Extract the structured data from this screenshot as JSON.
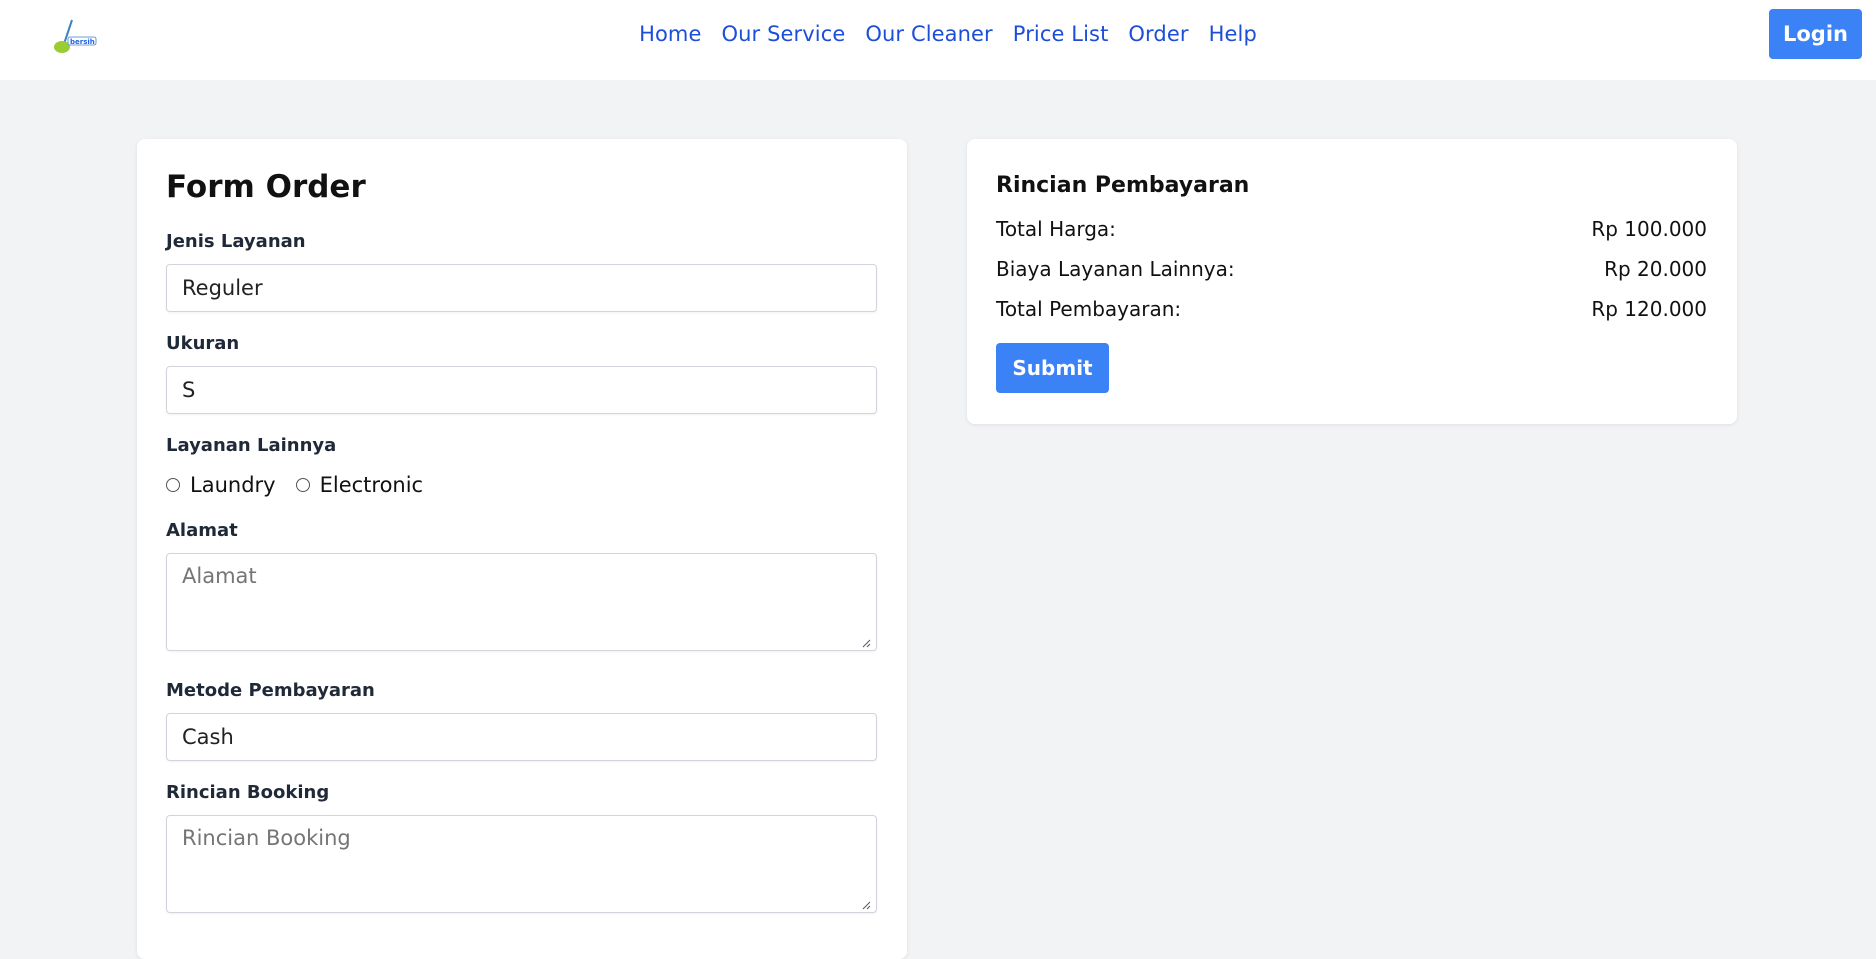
{
  "nav": {
    "logo_name": "broom-logo",
    "links": [
      "Home",
      "Our Service",
      "Our Cleaner",
      "Price List",
      "Order",
      "Help"
    ],
    "login_label": "Login"
  },
  "form": {
    "title": "Form Order",
    "service_type": {
      "label": "Jenis Layanan",
      "value": "Reguler"
    },
    "size": {
      "label": "Ukuran",
      "value": "S"
    },
    "other_services": {
      "label": "Layanan Lainnya",
      "options": [
        "Laundry",
        "Electronic"
      ]
    },
    "address": {
      "label": "Alamat",
      "placeholder": "Alamat"
    },
    "payment_method": {
      "label": "Metode Pembayaran",
      "value": "Cash"
    },
    "booking_details": {
      "label": "Rincian Booking",
      "placeholder": "Rincian Booking"
    }
  },
  "payment": {
    "title": "Rincian Pembayaran",
    "rows": [
      {
        "label": "Total Harga:",
        "value": "Rp 100.000"
      },
      {
        "label": "Biaya Layanan Lainnya:",
        "value": "Rp 20.000"
      },
      {
        "label": "Total Pembayaran:",
        "value": "Rp 120.000"
      }
    ],
    "submit_label": "Submit"
  },
  "colors": {
    "accent": "#3b82f6",
    "nav_link": "#1d4ed8",
    "page_bg": "#f2f3f5"
  }
}
